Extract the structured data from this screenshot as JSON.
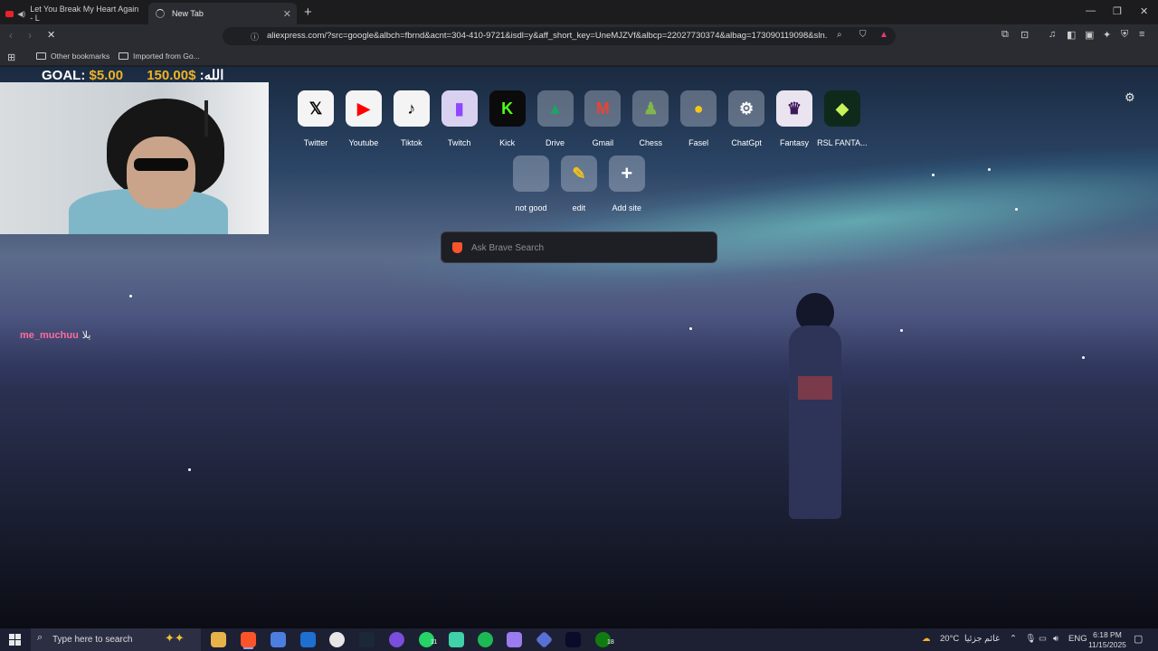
{
  "tabs": [
    {
      "title": "Let You Break My Heart Again - L"
    },
    {
      "title": "New Tab"
    }
  ],
  "address_bar": {
    "url": "aliexpress.com/?src=google&albch=fbrnd&acnt=304-410-9721&isdl=y&aff_short_key=UneMJZVf&albcp=22027730374&albag=173090119098&sln..."
  },
  "bookmarks": [
    {
      "label": "Other bookmarks"
    },
    {
      "label": "Imported from Go..."
    }
  ],
  "overlay": {
    "goal_prefix": "GOAL:",
    "goal_current": "$5.00",
    "goal_target": "150.00$",
    "goal_suffix": ":الله",
    "chat_user": "me_muchuu",
    "chat_message": "يلا"
  },
  "top_sites": [
    {
      "label": "Twitter",
      "icon": "x-icon",
      "color": "#000000"
    },
    {
      "label": "Youtube",
      "icon": "youtube-icon",
      "color": "#ff0000"
    },
    {
      "label": "Tiktok",
      "icon": "tiktok-icon",
      "color": "#000000"
    },
    {
      "label": "Twitch",
      "icon": "twitch-icon",
      "color": "#9146ff"
    },
    {
      "label": "Kick",
      "icon": "kick-icon",
      "color": "#53fc18"
    },
    {
      "label": "Drive",
      "icon": "drive-icon",
      "color": "#1fa463"
    },
    {
      "label": "Gmail",
      "icon": "gmail-icon",
      "color": "#ea4335"
    },
    {
      "label": "Chess",
      "icon": "chess-pawn-icon",
      "color": "#81b64c"
    },
    {
      "label": "Fasel",
      "icon": "lightbulb-icon",
      "color": "#f5c518"
    },
    {
      "label": "ChatGpt",
      "icon": "openai-icon",
      "color": "#ffffff"
    },
    {
      "label": "Fantasy",
      "icon": "premier-league-icon",
      "color": "#3d195b"
    },
    {
      "label": "RSL FANTA...",
      "icon": "rsl-fantasy-icon",
      "color": "#0f2a1a"
    }
  ],
  "top_sites_row2": [
    {
      "label": "not good",
      "icon": "blank-icon"
    },
    {
      "label": "edit",
      "icon": "edit-icon"
    },
    {
      "label": "Add site",
      "icon": "plus-icon"
    }
  ],
  "search": {
    "placeholder": "Ask Brave Search"
  },
  "taskbar": {
    "search_text": "Type here to search",
    "weather": "20°C",
    "weather_desc": "غائم جزئيا",
    "language": "ENG",
    "time": "6:18 PM",
    "date": "11/15/2025",
    "badges": {
      "whatsapp": "11",
      "xbox": "18"
    }
  }
}
